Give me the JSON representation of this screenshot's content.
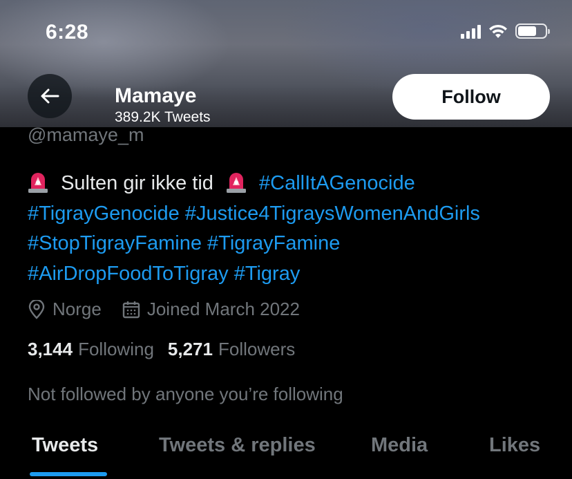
{
  "status_bar": {
    "time": "6:28"
  },
  "header": {
    "name": "Mamaye",
    "tweet_count": "389.2K Tweets",
    "follow_label": "Follow"
  },
  "profile": {
    "handle": "@mamaye_m",
    "bio": {
      "text_1": "Sulten gir ikke tid",
      "tags": [
        "#CallItAGenocide",
        "#TigrayGenocide",
        "#Justice4TigraysWomenAndGirls",
        "#StopTigrayFamine",
        "#TigrayFamine",
        "#AirDropFoodToTigray",
        "#Tigray"
      ]
    },
    "location": "Norge",
    "joined": "Joined March 2022",
    "following_count": "3,144",
    "following_label": "Following",
    "followers_count": "5,271",
    "followers_label": "Followers",
    "not_followed": "Not followed by anyone you’re following"
  },
  "tabs": [
    "Tweets",
    "Tweets & replies",
    "Media",
    "Likes"
  ],
  "colors": {
    "accent": "#1d9bf0",
    "background": "#000000",
    "muted": "#71767b"
  }
}
